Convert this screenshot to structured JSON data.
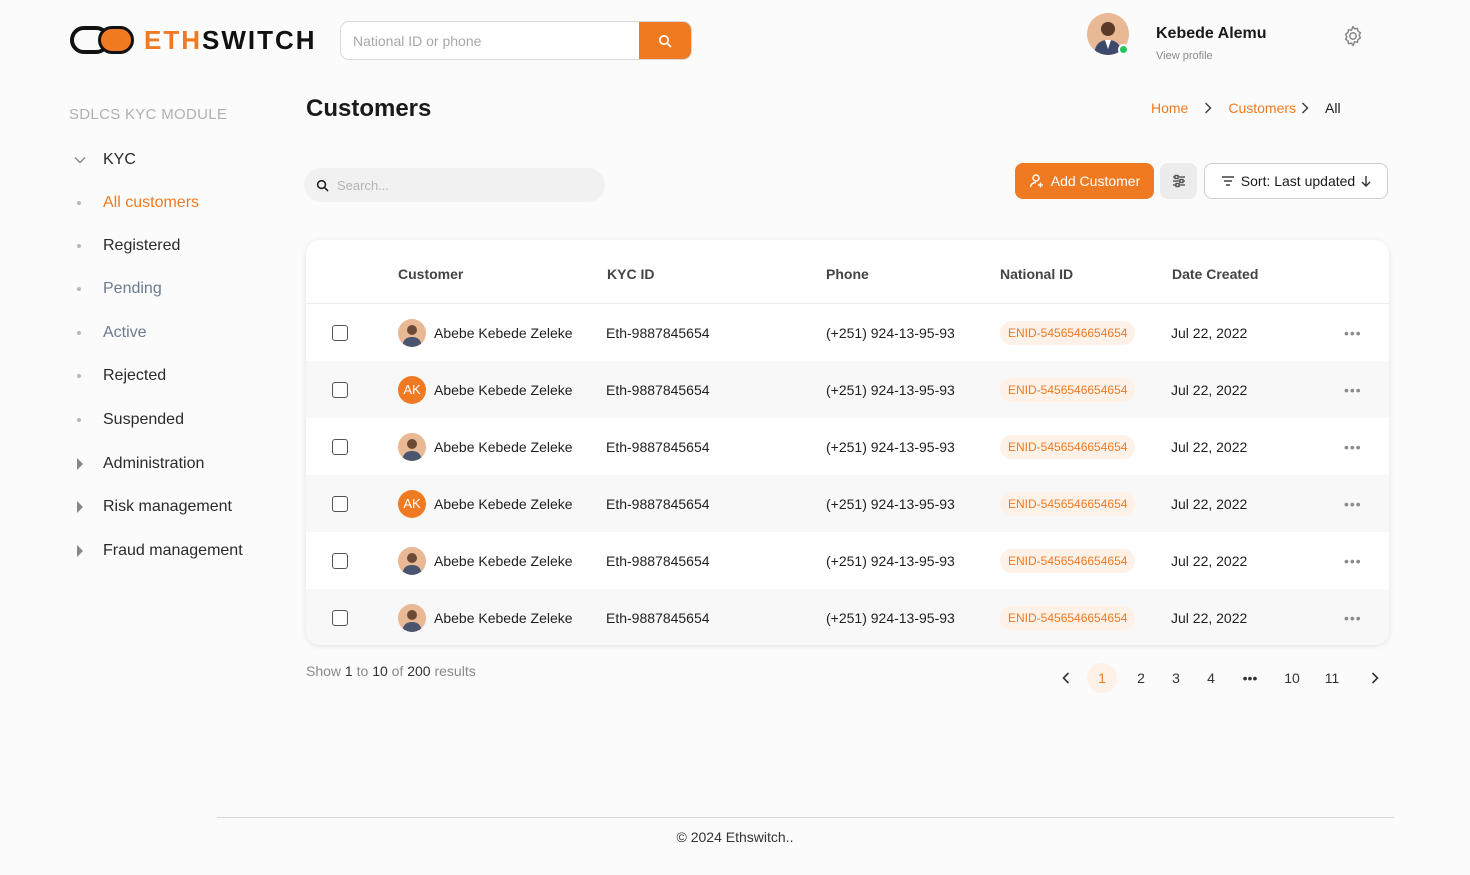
{
  "brand": {
    "part1": "ETH",
    "part2": "SWITCH"
  },
  "header": {
    "search_placeholder": "National ID or phone",
    "user_name": "Kebede Alemu",
    "user_sub": "View profile"
  },
  "sidebar": {
    "module_title": "SDLCS  KYC MODULE",
    "kyc_label": "KYC",
    "items": [
      {
        "label": "All customers"
      },
      {
        "label": "Registered"
      },
      {
        "label": "Pending"
      },
      {
        "label": "Active"
      },
      {
        "label": "Rejected"
      },
      {
        "label": "Suspended"
      }
    ],
    "groups": [
      {
        "label": "Administration"
      },
      {
        "label": "Risk management"
      },
      {
        "label": "Fraud management"
      }
    ]
  },
  "main": {
    "title": "Customers",
    "breadcrumb": {
      "home": "Home",
      "customers": "Customers",
      "current": "All"
    },
    "search_placeholder": "Search...",
    "add_label": "Add Customer",
    "sort_label": "Sort: Last updated"
  },
  "table": {
    "headers": {
      "customer": "Customer",
      "kyc": "KYC ID",
      "phone": "Phone",
      "nid": "National ID",
      "date": "Date Created"
    },
    "rows": [
      {
        "avatar": "photo",
        "initials": "",
        "name": "Abebe Kebede Zeleke",
        "kyc": "Eth-9887845654",
        "phone": "(+251) 924-13-95-93",
        "nid": "ENID-5456546654654",
        "date": "Jul 22, 2022"
      },
      {
        "avatar": "initials",
        "initials": "AK",
        "name": "Abebe Kebede Zeleke",
        "kyc": "Eth-9887845654",
        "phone": "(+251) 924-13-95-93",
        "nid": "ENID-5456546654654",
        "date": "Jul 22, 2022"
      },
      {
        "avatar": "photo",
        "initials": "",
        "name": "Abebe Kebede Zeleke",
        "kyc": "Eth-9887845654",
        "phone": "(+251) 924-13-95-93",
        "nid": "ENID-5456546654654",
        "date": "Jul 22, 2022"
      },
      {
        "avatar": "initials",
        "initials": "AK",
        "name": "Abebe Kebede Zeleke",
        "kyc": "Eth-9887845654",
        "phone": "(+251) 924-13-95-93",
        "nid": "ENID-5456546654654",
        "date": "Jul 22, 2022"
      },
      {
        "avatar": "photo",
        "initials": "",
        "name": "Abebe Kebede Zeleke",
        "kyc": "Eth-9887845654",
        "phone": "(+251) 924-13-95-93",
        "nid": "ENID-5456546654654",
        "date": "Jul 22, 2022"
      },
      {
        "avatar": "photo",
        "initials": "",
        "name": "Abebe Kebede Zeleke",
        "kyc": "Eth-9887845654",
        "phone": "(+251) 924-13-95-93",
        "nid": "ENID-5456546654654",
        "date": "Jul 22, 2022"
      }
    ],
    "more_label": "•••"
  },
  "pagination": {
    "show": "Show",
    "from": "1",
    "to_word": "to",
    "to": "10",
    "of_word": "of",
    "total": "200",
    "results_word": "results",
    "pages": [
      "1",
      "2",
      "3",
      "4",
      "•••",
      "10",
      "11"
    ]
  },
  "footer": {
    "copyright": "© 2024  Ethswitch.."
  },
  "colors": {
    "accent": "#f07a22",
    "online": "#22c55e"
  }
}
